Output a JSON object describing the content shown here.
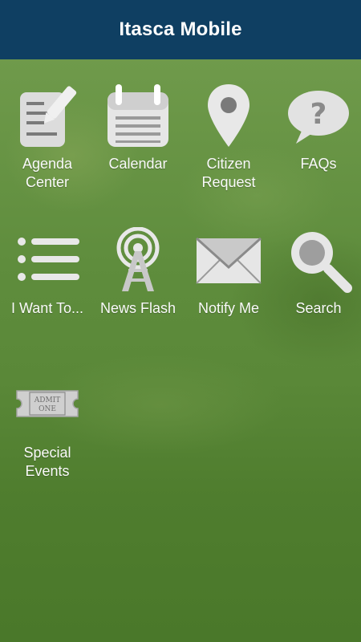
{
  "header": {
    "title": "Itasca Mobile"
  },
  "tiles": [
    {
      "label_line1": "Agenda",
      "label_line2": "Center",
      "icon": "agenda-edit-icon"
    },
    {
      "label_line1": "Calendar",
      "label_line2": "",
      "icon": "calendar-icon"
    },
    {
      "label_line1": "Citizen",
      "label_line2": "Request",
      "icon": "map-pin-icon"
    },
    {
      "label_line1": "FAQs",
      "label_line2": "",
      "icon": "question-bubble-icon"
    },
    {
      "label_line1": "I Want To...",
      "label_line2": "",
      "icon": "list-icon"
    },
    {
      "label_line1": "News Flash",
      "label_line2": "",
      "icon": "broadcast-tower-icon"
    },
    {
      "label_line1": "Notify Me",
      "label_line2": "",
      "icon": "envelope-icon"
    },
    {
      "label_line1": "Search",
      "label_line2": "",
      "icon": "search-icon"
    },
    {
      "label_line1": "Special",
      "label_line2": "Events",
      "icon": "ticket-icon"
    }
  ],
  "ticket": {
    "line1": "ADMIT",
    "line2": "ONE"
  },
  "colors": {
    "header": "#0f3f62",
    "icon": "#e8e8e8",
    "icon_dark": "#7a7a7a"
  }
}
